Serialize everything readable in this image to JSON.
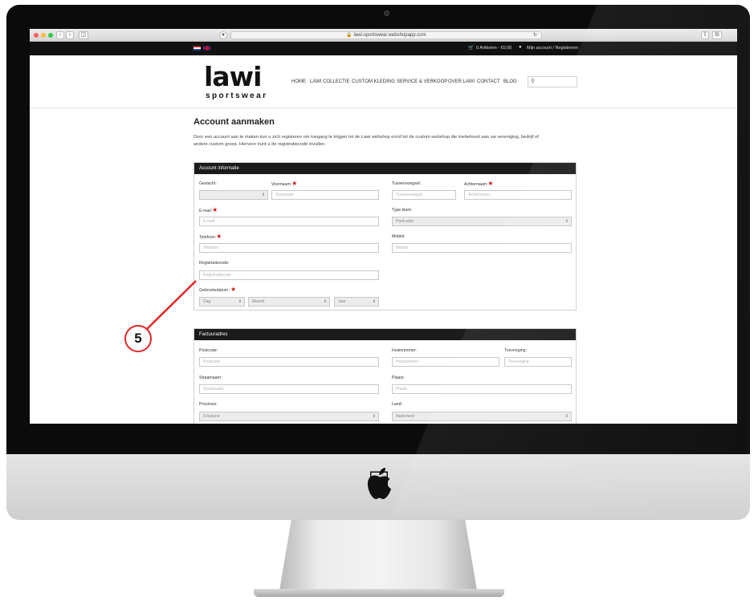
{
  "browser": {
    "url": "lawi-sportswear.webshopapp.com",
    "reload_icon": "reload-icon",
    "lock_icon": "lock-icon"
  },
  "topbar": {
    "cart": "0 Artikelen - €0,00",
    "account": "Mijn account / Registreren",
    "flags": [
      "nl-flag",
      "uk-flag"
    ]
  },
  "site": {
    "logo_main": "lawi",
    "logo_sub": "sportswear"
  },
  "nav": {
    "home": "HOME",
    "collectie": "LAWI COLLECTIE",
    "custom": "CUSTOM KLEDING",
    "service": "SERVICE & VERKOOP",
    "over": "OVER LAWI",
    "contact": "CONTACT",
    "blog": "BLOG",
    "search_icon": "search-icon"
  },
  "page": {
    "title": "Account aanmaken",
    "intro_line1": "Door een account aan te maken kun u zich registeren om toegang te krijgen tot de Lawi webshop en/of tot de custom webshop die toebehoort aan uw vereniging, bedrijf of",
    "intro_line2": "andere custom groep. Hiervoor kunt u de registratiecode invullen."
  },
  "account_section": {
    "header": "Account informatie",
    "geslacht": {
      "label": "Geslacht :",
      "value": ""
    },
    "voornaam": {
      "label": "Voornaam:",
      "placeholder": "Voornaam"
    },
    "tussenvoegsel": {
      "label": "Tussenvoegsel:",
      "placeholder": "Tussenvoegsel"
    },
    "achternaam": {
      "label": "Achternaam:",
      "placeholder": "Achternaam"
    },
    "email": {
      "label": "E-mail:",
      "placeholder": "E-mail"
    },
    "type_klant": {
      "label": "Type klant:",
      "value": "Particulier"
    },
    "telefoon": {
      "label": "Telefoon:",
      "placeholder": "Telefoon"
    },
    "mobiel": {
      "label": "Mobiel:",
      "placeholder": "Mobiel"
    },
    "registratiecode": {
      "label": "Registratiecode:",
      "placeholder": "Registratiecode"
    },
    "geboortedatum": {
      "label": "Geboortedatum :",
      "dag": "Dag",
      "maand": "Maand",
      "jaar": "Jaar"
    }
  },
  "factuur_section": {
    "header": "Factuuradres",
    "postcode": {
      "label": "Postcode:",
      "placeholder": "Postcode"
    },
    "huisnummer": {
      "label": "Huisnummer:",
      "placeholder": "Huisnummer"
    },
    "toevoeging": {
      "label": "Toevoeging:",
      "placeholder": "Toevoeging"
    },
    "straatnaam": {
      "label": "Straatnaam:",
      "placeholder": "Straatnaam"
    },
    "plaats": {
      "label": "Plaats:",
      "placeholder": "Plaats"
    },
    "provincie": {
      "label": "Provincie:",
      "value": "Friesland"
    },
    "land": {
      "label": "Land:",
      "value": "Nederland"
    }
  },
  "required_mark": "★",
  "callout": {
    "number": "5"
  },
  "colors": {
    "callout": "#e12626",
    "required": "#d01919",
    "section_header": "#1b1b1b",
    "topbar": "#111111"
  }
}
